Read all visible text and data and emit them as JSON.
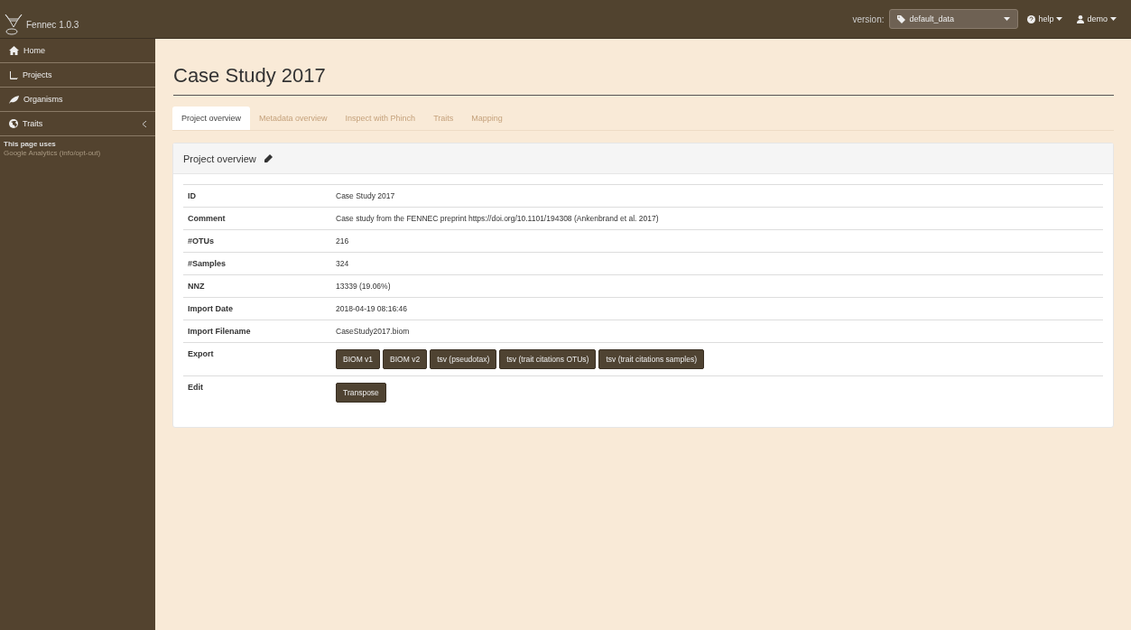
{
  "app": {
    "name": "Fennec 1.0.3"
  },
  "topbar": {
    "version_label": "version:",
    "version_value": "default_data",
    "help": "help",
    "user": "demo"
  },
  "sidebar": {
    "items": [
      {
        "label": "Home",
        "expandable": false
      },
      {
        "label": "Projects",
        "expandable": false
      },
      {
        "label": "Organisms",
        "expandable": false
      },
      {
        "label": "Traits",
        "expandable": true
      }
    ],
    "notice": {
      "text": "This page uses",
      "link": "Google Analytics (info/opt-out)"
    }
  },
  "page": {
    "title": "Case Study 2017",
    "tabs": [
      {
        "label": "Project overview",
        "selected": true
      },
      {
        "label": "Metadata overview",
        "selected": false
      },
      {
        "label": "Inspect with Phinch",
        "selected": false
      },
      {
        "label": "Traits",
        "selected": false
      },
      {
        "label": "Mapping",
        "selected": false
      }
    ],
    "panel": {
      "title": "Project overview",
      "rows": [
        {
          "kind": "text",
          "label": "ID",
          "value": "Case Study 2017"
        },
        {
          "kind": "text",
          "label": "Comment",
          "value": "Case study from the FENNEC preprint https://doi.org/10.1101/194308 (Ankenbrand et al. 2017)"
        },
        {
          "kind": "text",
          "label": "#OTUs",
          "value": "216"
        },
        {
          "kind": "text",
          "label": "#Samples",
          "value": "324"
        },
        {
          "kind": "text",
          "label": "NNZ",
          "value": "13339 (19.06%)"
        },
        {
          "kind": "text",
          "label": "Import Date",
          "value": "2018-04-19 08:16:46"
        },
        {
          "kind": "text",
          "label": "Import Filename",
          "value": "CaseStudy2017.biom"
        },
        {
          "kind": "buttons",
          "label": "Export",
          "buttons": [
            "BIOM v1",
            "BIOM v2",
            "tsv (pseudotax)",
            "tsv (trait citations OTUs)",
            "tsv (trait citations samples)"
          ]
        },
        {
          "kind": "buttons",
          "label": "Edit",
          "buttons": [
            "Transpose"
          ]
        }
      ]
    }
  }
}
